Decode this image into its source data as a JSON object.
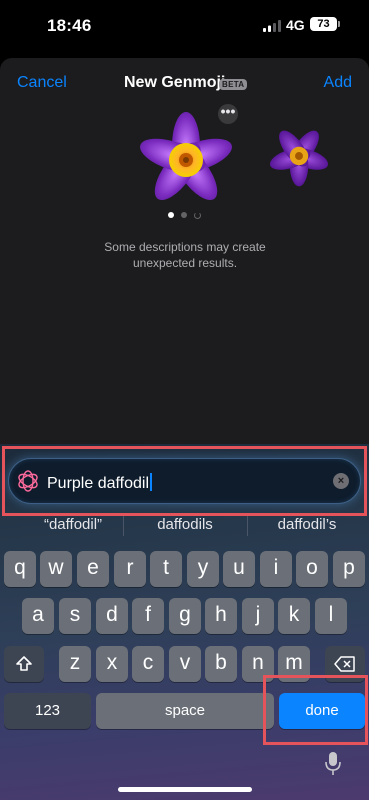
{
  "status_bar": {
    "time": "18:46",
    "network": "4G",
    "battery": "73"
  },
  "nav": {
    "cancel": "Cancel",
    "title": "New Genmoji",
    "beta": "BETA",
    "add": "Add"
  },
  "preview": {
    "more": "•••",
    "note_line1": "Some descriptions may create",
    "note_line2": "unexpected results.",
    "page_count": 3,
    "active_page": 1
  },
  "input": {
    "value": "Purple daffodil",
    "clear": "×"
  },
  "suggestions": [
    "“daffodil”",
    "daffodils",
    "daffodil’s"
  ],
  "keyboard": {
    "row1": [
      "q",
      "w",
      "e",
      "r",
      "t",
      "y",
      "u",
      "i",
      "o",
      "p"
    ],
    "row2": [
      "a",
      "s",
      "d",
      "f",
      "g",
      "h",
      "j",
      "k",
      "l"
    ],
    "row3": [
      "z",
      "x",
      "c",
      "v",
      "b",
      "n",
      "m"
    ],
    "numbers": "123",
    "space": "space",
    "done": "done"
  },
  "colors": {
    "accent": "#0a84ff",
    "flower_petal": "#8a2be2",
    "flower_center": "#f5a623",
    "highlight": "#e5535b"
  }
}
